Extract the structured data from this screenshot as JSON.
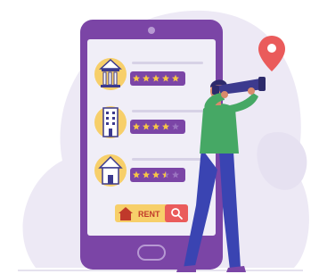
{
  "search_bar": {
    "label": "RENT"
  },
  "listings": [
    {
      "type": "building-columns",
      "stars": 5
    },
    {
      "type": "office-building",
      "stars": 4
    },
    {
      "type": "house",
      "stars": 3.5
    }
  ],
  "colors": {
    "phone_frame": "#7b45a6",
    "phone_screen": "#f0eef7",
    "background_blob": "#ede9f5",
    "star_pill": "#7b45a6",
    "star": "#f6c544",
    "icon_circle": "#f7cf6a",
    "rent_bar": "#f7cf6a",
    "search_button": "#ea5b5b",
    "location_pin": "#ea5b5b",
    "person_shirt": "#46a865",
    "person_pants": "#3a44b2",
    "telescope": "#3c3a8e"
  }
}
